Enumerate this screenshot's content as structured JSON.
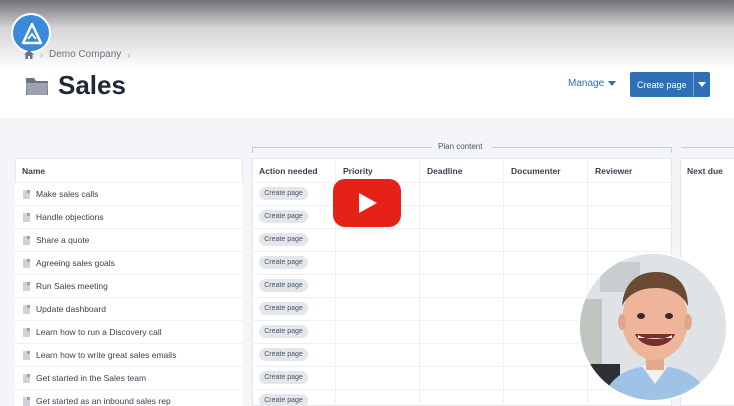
{
  "breadcrumb": {
    "company": "Demo Company"
  },
  "page": {
    "title": "Sales"
  },
  "header": {
    "manage_label": "Manage",
    "create_label": "Create page"
  },
  "plan_group_label": "Plan content",
  "columns": {
    "name": "Name",
    "action": "Action needed",
    "priority": "Priority",
    "deadline": "Deadline",
    "documenter": "Documenter",
    "reviewer": "Reviewer",
    "next_due": "Next due"
  },
  "rows": [
    {
      "name": "Make sales calls",
      "action": "Create page"
    },
    {
      "name": "Handle objections",
      "action": "Create page"
    },
    {
      "name": "Share a quote",
      "action": "Create page"
    },
    {
      "name": "Agreeing sales goals",
      "action": "Create page"
    },
    {
      "name": "Run Sales meeting",
      "action": "Create page"
    },
    {
      "name": "Update dashboard",
      "action": "Create page"
    },
    {
      "name": "Learn how to run a Discovery call",
      "action": "Create page"
    },
    {
      "name": "Learn how to write great sales emails",
      "action": "Create page"
    },
    {
      "name": "Get started in the Sales team",
      "action": "Create page"
    },
    {
      "name": "Get started as an inbound sales rep",
      "action": "Create page"
    }
  ],
  "colors": {
    "accent": "#2f6fb6",
    "logo": "#3b8ad9",
    "youtube": "#e62117"
  },
  "icons": [
    "home-icon",
    "folder-icon",
    "chevron-down-icon",
    "document-icon",
    "play-icon"
  ]
}
